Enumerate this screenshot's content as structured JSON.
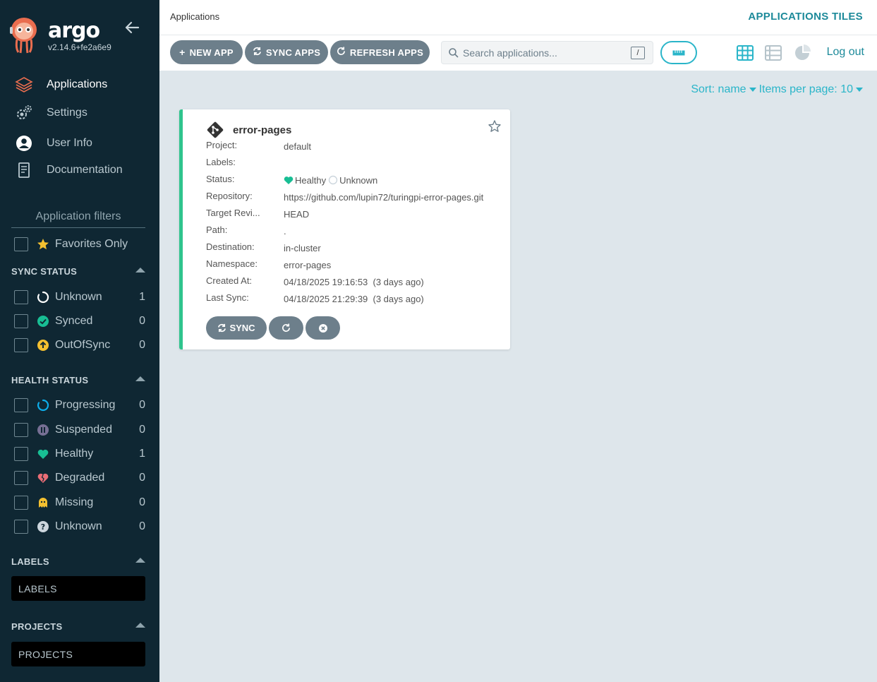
{
  "app": {
    "brand": "argo",
    "version": "v2.14.6+fe2a6e9"
  },
  "nav": [
    {
      "label": "Applications",
      "icon": "layers-icon",
      "active": true
    },
    {
      "label": "Settings",
      "icon": "gears-icon"
    },
    {
      "label": "User Info",
      "icon": "user-circle-icon"
    },
    {
      "label": "Documentation",
      "icon": "book-icon"
    }
  ],
  "filters": {
    "title": "Application filters",
    "favorites_label": "Favorites Only",
    "sync_status": {
      "title": "SYNC STATUS",
      "items": [
        {
          "label": "Unknown",
          "count": "1",
          "icon": "circle-notch-icon",
          "color": "#ffffff"
        },
        {
          "label": "Synced",
          "count": "0",
          "icon": "check-circle-icon",
          "color": "#18be94"
        },
        {
          "label": "OutOfSync",
          "count": "0",
          "icon": "arrow-up-circle-icon",
          "color": "#f4c030"
        }
      ]
    },
    "health_status": {
      "title": "HEALTH STATUS",
      "items": [
        {
          "label": "Progressing",
          "count": "0",
          "icon": "progress-ring-icon",
          "color": "#0dadea"
        },
        {
          "label": "Suspended",
          "count": "0",
          "icon": "pause-circle-icon",
          "color": "#766f94"
        },
        {
          "label": "Healthy",
          "count": "1",
          "icon": "heart-icon",
          "color": "#18be94"
        },
        {
          "label": "Degraded",
          "count": "0",
          "icon": "broken-heart-icon",
          "color": "#e96d76"
        },
        {
          "label": "Missing",
          "count": "0",
          "icon": "ghost-icon",
          "color": "#f4c030"
        },
        {
          "label": "Unknown",
          "count": "0",
          "icon": "question-circle-icon",
          "color": "#ccd6dd"
        }
      ]
    },
    "labels": {
      "title": "LABELS",
      "placeholder": "LABELS"
    },
    "projects": {
      "title": "PROJECTS",
      "placeholder": "PROJECTS"
    }
  },
  "header": {
    "breadcrumb": "Applications",
    "title": "APPLICATIONS TILES"
  },
  "toolbar": {
    "new_app": "NEW APP",
    "sync_apps": "SYNC APPS",
    "refresh_apps": "REFRESH APPS",
    "search_placeholder": "Search applications...",
    "search_shortcut": "/",
    "logout": "Log out"
  },
  "sort": {
    "sort_label": "Sort: name",
    "per_page_label": "Items per page: 10"
  },
  "card": {
    "name": "error-pages",
    "fields": [
      {
        "key": "Project:",
        "value": "default"
      },
      {
        "key": "Labels:",
        "value": ""
      },
      {
        "key": "Status:",
        "health": "Healthy",
        "sync": "Unknown"
      },
      {
        "key": "Repository:",
        "value": "https://github.com/lupin72/turingpi-error-pages.git"
      },
      {
        "key": "Target Revi...",
        "value": "HEAD"
      },
      {
        "key": "Path:",
        "value": "."
      },
      {
        "key": "Destination:",
        "value": "in-cluster"
      },
      {
        "key": "Namespace:",
        "value": "error-pages"
      },
      {
        "key": "Created At:",
        "value": "04/18/2025 19:16:53  (3 days ago)"
      },
      {
        "key": "Last Sync:",
        "value": "04/18/2025 21:29:39  (3 days ago)"
      }
    ],
    "sync_label": "SYNC"
  },
  "colors": {
    "sidebar_bg": "#0f2733",
    "accent": "#2ab5c9",
    "healthy": "#18be94",
    "button": "#6d7f8b"
  }
}
